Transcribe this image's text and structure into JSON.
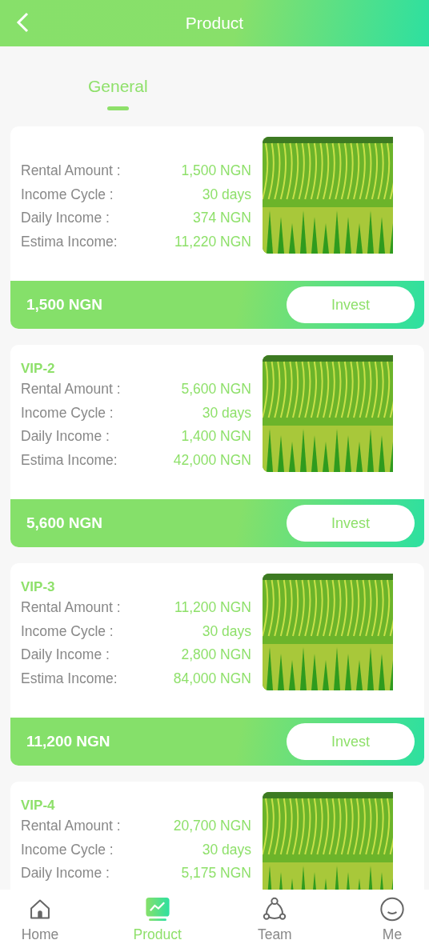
{
  "header": {
    "title": "Product"
  },
  "tabs": [
    {
      "label": "General",
      "selected": true
    }
  ],
  "products": [
    {
      "rows": [
        {
          "label": "Rental Amount :",
          "value": "1,500 NGN"
        },
        {
          "label": "Income Cycle :",
          "value": "30 days"
        },
        {
          "label": "Daily Income :",
          "value": "374 NGN"
        },
        {
          "label": "Estima Income:",
          "value": "11,220 NGN"
        }
      ],
      "price": "1,500 NGN",
      "button": "Invest"
    },
    {
      "name": "VIP-2",
      "rows": [
        {
          "label": "Rental Amount :",
          "value": "5,600 NGN"
        },
        {
          "label": "Income Cycle :",
          "value": "30 days"
        },
        {
          "label": "Daily Income :",
          "value": "1,400 NGN"
        },
        {
          "label": "Estima Income:",
          "value": "42,000 NGN"
        }
      ],
      "price": "5,600 NGN",
      "button": "Invest"
    },
    {
      "name": "VIP-3",
      "rows": [
        {
          "label": "Rental Amount :",
          "value": "11,200 NGN"
        },
        {
          "label": "Income Cycle :",
          "value": "30 days"
        },
        {
          "label": "Daily Income :",
          "value": "2,800 NGN"
        },
        {
          "label": "Estima Income:",
          "value": "84,000 NGN"
        }
      ],
      "price": "11,200 NGN",
      "button": "Invest"
    },
    {
      "name": "VIP-4",
      "rows": [
        {
          "label": "Rental Amount :",
          "value": "20,700 NGN"
        },
        {
          "label": "Income Cycle :",
          "value": "30 days"
        },
        {
          "label": "Daily Income :",
          "value": "5,175 NGN"
        }
      ]
    }
  ],
  "nav": [
    {
      "label": "Home",
      "selected": false
    },
    {
      "label": "Product",
      "selected": true
    },
    {
      "label": "Team",
      "selected": false
    },
    {
      "label": "Me",
      "selected": false
    }
  ]
}
